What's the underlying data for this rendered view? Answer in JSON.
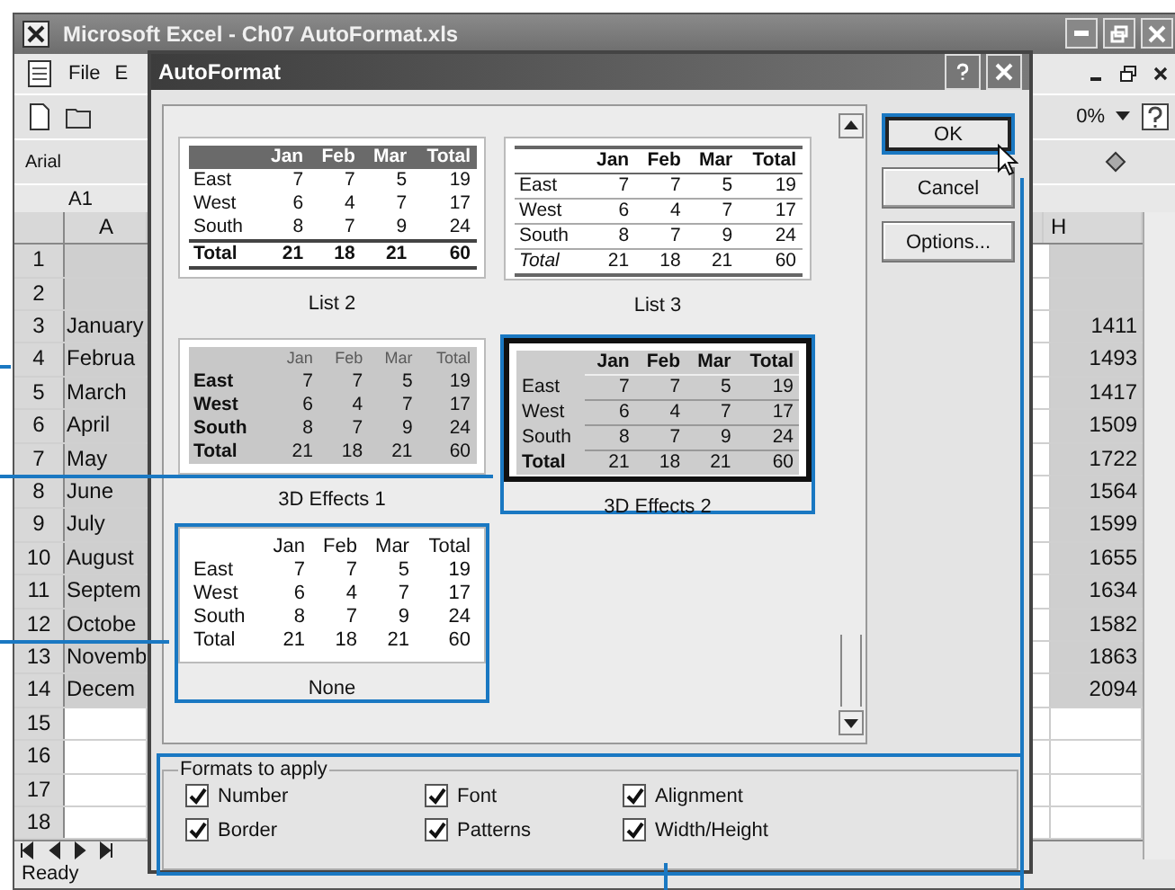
{
  "excel": {
    "title": "Microsoft Excel - Ch07 AutoFormat.xls",
    "menu": [
      "File",
      "E"
    ],
    "zoom": "0%",
    "font_box": "Arial",
    "name_box": "A1",
    "columns": [
      "A",
      "H"
    ],
    "rows": [
      {
        "num": "1"
      },
      {
        "num": "2"
      },
      {
        "num": "3",
        "a": "January",
        "h": "1411"
      },
      {
        "num": "4",
        "a": "Februa",
        "h": "1493"
      },
      {
        "num": "5",
        "a": "March",
        "h": "1417"
      },
      {
        "num": "6",
        "a": "April",
        "h": "1509"
      },
      {
        "num": "7",
        "a": "May",
        "h": "1722"
      },
      {
        "num": "8",
        "a": "June",
        "h": "1564"
      },
      {
        "num": "9",
        "a": "July",
        "h": "1599"
      },
      {
        "num": "10",
        "a": "August",
        "h": "1655"
      },
      {
        "num": "11",
        "a": "Septem",
        "h": "1634"
      },
      {
        "num": "12",
        "a": "Octobe",
        "h": "1582"
      },
      {
        "num": "13",
        "a": "Novemb",
        "h": "1863"
      },
      {
        "num": "14",
        "a": "Decem",
        "h": "2094"
      },
      {
        "num": "15"
      },
      {
        "num": "16"
      },
      {
        "num": "17"
      },
      {
        "num": "18"
      }
    ],
    "status": "Ready"
  },
  "dialog": {
    "title": "AutoFormat",
    "formats": [
      {
        "kind": "list2",
        "label": "List 2",
        "selected": false,
        "highlighted": false,
        "table": {
          "header": [
            "Jan",
            "Feb",
            "Mar",
            "Total"
          ],
          "rows": [
            [
              "East",
              "7",
              "7",
              "5",
              "19"
            ],
            [
              "West",
              "6",
              "4",
              "7",
              "17"
            ],
            [
              "South",
              "8",
              "7",
              "9",
              "24"
            ],
            [
              "Total",
              "21",
              "18",
              "21",
              "60"
            ]
          ]
        }
      },
      {
        "kind": "list3",
        "label": "List 3",
        "selected": false,
        "highlighted": false,
        "table": {
          "header": [
            "Jan",
            "Feb",
            "Mar",
            "Total"
          ],
          "rows": [
            [
              "East",
              "7",
              "7",
              "5",
              "19"
            ],
            [
              "West",
              "6",
              "4",
              "7",
              "17"
            ],
            [
              "South",
              "8",
              "7",
              "9",
              "24"
            ],
            [
              "Total",
              "21",
              "18",
              "21",
              "60"
            ]
          ]
        }
      },
      {
        "kind": "effects1",
        "label": "3D Effects 1",
        "selected": false,
        "highlighted": false,
        "table": {
          "header": [
            "Jan",
            "Feb",
            "Mar",
            "Total"
          ],
          "rows": [
            [
              "East",
              "7",
              "7",
              "5",
              "19"
            ],
            [
              "West",
              "6",
              "4",
              "7",
              "17"
            ],
            [
              "South",
              "8",
              "7",
              "9",
              "24"
            ],
            [
              "Total",
              "21",
              "18",
              "21",
              "60"
            ]
          ]
        }
      },
      {
        "kind": "effects2",
        "label": "3D Effects 2",
        "selected": true,
        "highlighted": true,
        "table": {
          "header": [
            "Jan",
            "Feb",
            "Mar",
            "Total"
          ],
          "rows": [
            [
              "East",
              "7",
              "7",
              "5",
              "19"
            ],
            [
              "West",
              "6",
              "4",
              "7",
              "17"
            ],
            [
              "South",
              "8",
              "7",
              "9",
              "24"
            ],
            [
              "Total",
              "21",
              "18",
              "21",
              "60"
            ]
          ]
        }
      },
      {
        "kind": "none",
        "label": "None",
        "selected": false,
        "highlighted": true,
        "table": {
          "header": [
            "Jan",
            "Feb",
            "Mar",
            "Total"
          ],
          "rows": [
            [
              "East",
              "7",
              "7",
              "5",
              "19"
            ],
            [
              "West",
              "6",
              "4",
              "7",
              "17"
            ],
            [
              "South",
              "8",
              "7",
              "9",
              "24"
            ],
            [
              "Total",
              "21",
              "18",
              "21",
              "60"
            ]
          ]
        }
      }
    ],
    "buttons": [
      {
        "label": "OK",
        "kind": "default",
        "highlighted": true
      },
      {
        "label": "Cancel",
        "kind": "normal",
        "highlighted": false
      },
      {
        "label": "Options...",
        "kind": "normal",
        "highlighted": false
      }
    ],
    "group_title": "Formats to apply",
    "group_highlighted": true,
    "options": [
      {
        "label": "Number",
        "checked": true
      },
      {
        "label": "Font",
        "checked": true
      },
      {
        "label": "Alignment",
        "checked": true
      },
      {
        "label": "Border",
        "checked": true
      },
      {
        "label": "Patterns",
        "checked": true
      },
      {
        "label": "Width/Height",
        "checked": true
      }
    ]
  }
}
